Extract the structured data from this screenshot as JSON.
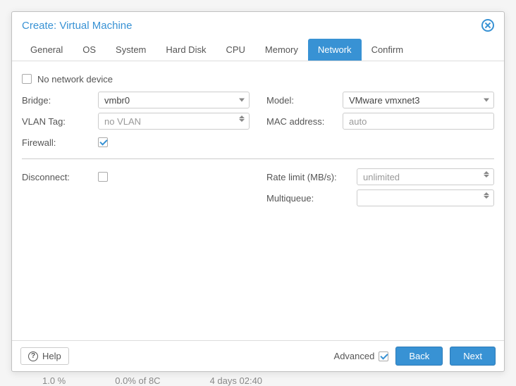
{
  "dialog": {
    "title": "Create: Virtual Machine"
  },
  "tabs": [
    {
      "id": "general",
      "label": "General"
    },
    {
      "id": "os",
      "label": "OS"
    },
    {
      "id": "system",
      "label": "System"
    },
    {
      "id": "harddisk",
      "label": "Hard Disk"
    },
    {
      "id": "cpu",
      "label": "CPU"
    },
    {
      "id": "memory",
      "label": "Memory"
    },
    {
      "id": "network",
      "label": "Network"
    },
    {
      "id": "confirm",
      "label": "Confirm"
    }
  ],
  "activeTab": "network",
  "form": {
    "noNetwork": {
      "label": "No network device",
      "checked": false
    },
    "bridge": {
      "label": "Bridge:",
      "value": "vmbr0"
    },
    "vlan": {
      "label": "VLAN Tag:",
      "value": "no VLAN"
    },
    "firewall": {
      "label": "Firewall:",
      "checked": true
    },
    "model": {
      "label": "Model:",
      "value": "VMware vmxnet3"
    },
    "mac": {
      "label": "MAC address:",
      "value": "auto"
    },
    "disconnect": {
      "label": "Disconnect:",
      "checked": false
    },
    "rate": {
      "label": "Rate limit (MB/s):",
      "value": "unlimited"
    },
    "multiqueue": {
      "label": "Multiqueue:",
      "value": ""
    }
  },
  "footer": {
    "help": "Help",
    "advanced": {
      "label": "Advanced",
      "checked": true
    },
    "back": "Back",
    "next": "Next"
  },
  "background": {
    "col1": "1.0 %",
    "col2": "0.0% of 8C",
    "col3": "4 days 02:40"
  }
}
